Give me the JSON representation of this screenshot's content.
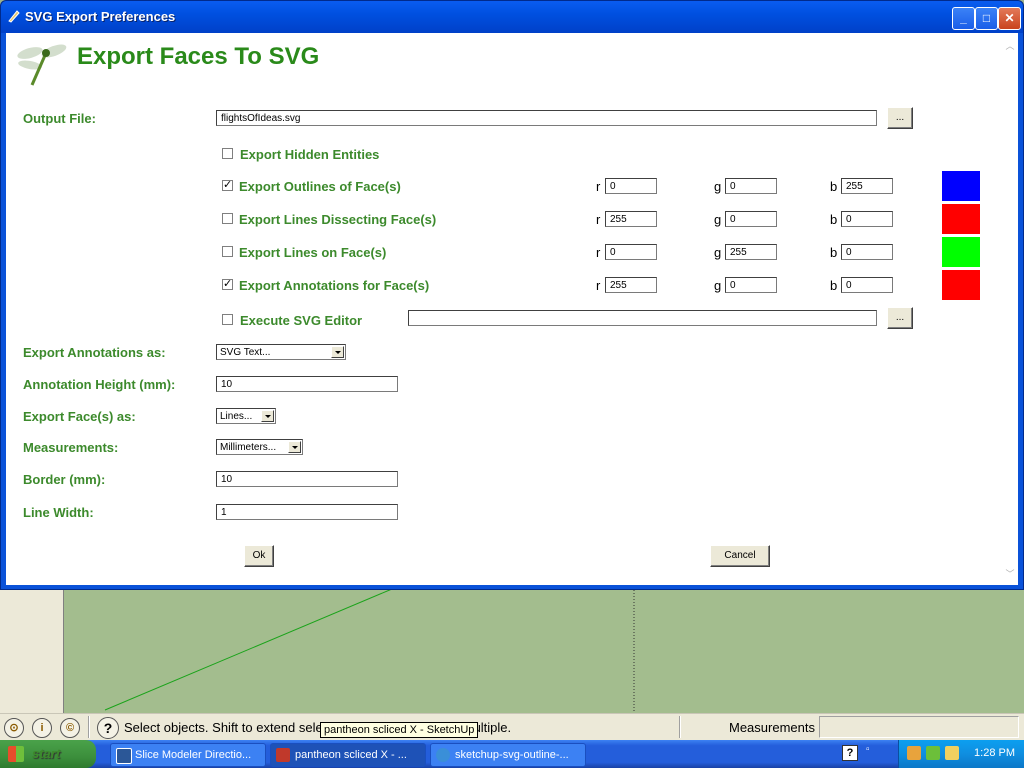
{
  "window": {
    "title": "SVG Export Preferences"
  },
  "dialog": {
    "heading": "Export Faces To SVG",
    "output_file": {
      "label": "Output File:",
      "value": "flightsOfIdeas.svg",
      "browse": "..."
    },
    "export_hidden": {
      "label": "Export Hidden Entities",
      "checked": false
    },
    "rows": [
      {
        "label": "Export Outlines of Face(s)",
        "checked": true,
        "r": "0",
        "g": "0",
        "b": "255",
        "color": "#0000ff"
      },
      {
        "label": "Export Lines Dissecting Face(s)",
        "checked": false,
        "r": "255",
        "g": "0",
        "b": "0",
        "color": "#ff0000"
      },
      {
        "label": "Export Lines on Face(s)",
        "checked": false,
        "r": "0",
        "g": "255",
        "b": "0",
        "color": "#00ff00"
      },
      {
        "label": "Export Annotations for Face(s)",
        "checked": true,
        "r": "255",
        "g": "0",
        "b": "0",
        "color": "#ff0000"
      }
    ],
    "rgb_labels": {
      "r": "r",
      "g": "g",
      "b": "b"
    },
    "execute_editor": {
      "label": "Execute SVG Editor",
      "checked": false,
      "value": "",
      "browse": "..."
    },
    "annotations_as": {
      "label": "Export Annotations as:",
      "value": "SVG Text..."
    },
    "annotation_height": {
      "label": "Annotation Height (mm):",
      "value": "10"
    },
    "faces_as": {
      "label": "Export Face(s) as:",
      "value": "Lines..."
    },
    "measurements": {
      "label": "Measurements:",
      "value": "Millimeters..."
    },
    "border": {
      "label": "Border (mm):",
      "value": "10"
    },
    "line_width": {
      "label": "Line Width:",
      "value": "1"
    },
    "ok": "Ok",
    "cancel": "Cancel"
  },
  "statusbar": {
    "text": "Select objects. Shift to extend sele",
    "text_tail": "multiple.",
    "tooltip": "pantheon scliced X - SketchUp",
    "measurements": "Measurements"
  },
  "taskbar": {
    "start": "start",
    "tasks": [
      {
        "label": "Slice Modeler Directio...",
        "icon_color": "#2b5797"
      },
      {
        "label": "pantheon scliced X - ...",
        "icon_color": "#c0392b"
      },
      {
        "label": "sketchup-svg-outline-...",
        "icon_color": "#3a8fd8"
      }
    ],
    "clock": "1:28 PM"
  }
}
